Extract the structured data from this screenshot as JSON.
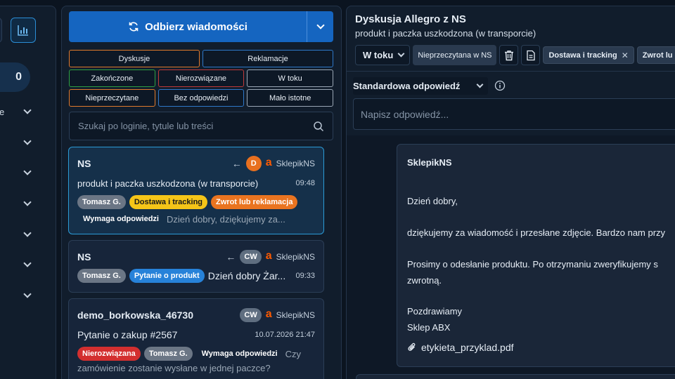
{
  "sidebar": {
    "counter": "0",
    "row_fragment": "e"
  },
  "toolbar_left": {
    "fetch_label": "Odbierz wiadomości"
  },
  "filters": [
    "Dyskusje",
    "Reklamacje",
    "Zakończone",
    "Nierozwiązane",
    "W toku",
    "Nieprzeczytane",
    "Bez odpowiedzi",
    "Mało istotne"
  ],
  "search": {
    "placeholder": "Szukaj po loginie, tytule lub treści"
  },
  "conversations": [
    {
      "name": "NS",
      "badge": "D",
      "channel": "SklepikNS",
      "subject": "produkt i paczka uszkodzona (w transporcie)",
      "time": "09:48",
      "tags": [
        "Tomasz G.",
        "Dostawa i tracking",
        "Zwrot lub reklamacja",
        "Wymaga odpowiedzi"
      ],
      "snippet": "Dzień dobry, dziękujemy za..."
    },
    {
      "name": "NS",
      "badge": "CW",
      "channel": "SklepikNS",
      "tags": [
        "Tomasz G.",
        "Pytanie o produkt"
      ],
      "snippet": "Dzień dobry Żar...",
      "time": "09:33"
    },
    {
      "name": "demo_borkowska_46730",
      "badge": "CW",
      "channel": "SklepikNS",
      "subject": "Pytanie o zakup #2567",
      "time": "10.07.2026 21:47",
      "tags": [
        "Nierozwiązana",
        "Tomasz G.",
        "Wymaga odpowiedzi"
      ],
      "snippet_a": "Czy",
      "snippet_b": "zamówienie zostanie wysłane w jednej paczce?"
    }
  ],
  "detail": {
    "title": "Dyskusja Allegro z NS",
    "subtitle": "produkt i paczka uszkodzona (w transporcie)",
    "status": "W toku",
    "unread": "Nieprzeczytana w NS",
    "tags": [
      "Dostawa i tracking",
      "Zwrot lu"
    ],
    "std_reply_label": "Standardowa odpowiedź",
    "reply_placeholder": "Napisz odpowiedź...",
    "message": {
      "sender": "SklepikNS",
      "lines": [
        "Dzień dobry,",
        "dziękujemy za wiadomość i przesłane zdjęcie. Bardzo nam przy",
        "Prosimy o odesłanie produktu. Po otrzymaniu zweryfikujemy s",
        "zwrotną.",
        "Pozdrawiamy",
        "Sklep ABX"
      ],
      "attachment": "etykieta_przyklad.pdf"
    }
  },
  "colors": {
    "primary": "#1565c0",
    "active_card": "#2b9bd6",
    "allegro": "#ff5a00"
  }
}
